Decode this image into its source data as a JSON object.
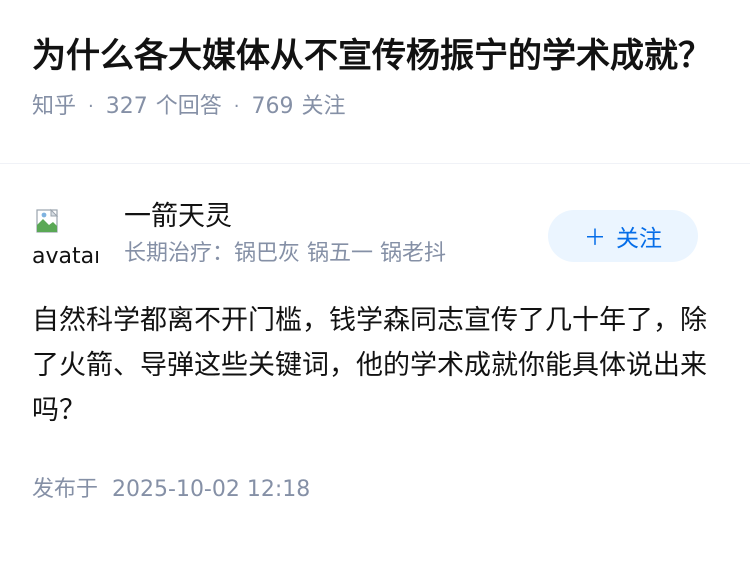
{
  "question": {
    "title": "为什么各大媒体从不宣传杨振宁的学术成就？",
    "source": "知乎",
    "answer_count": "327",
    "answer_label": "个回答",
    "follow_count": "769",
    "follow_label": "关注",
    "separator": "·"
  },
  "answer": {
    "author": {
      "name": "一箭天灵",
      "bio": "长期治疗：锅巴灰 锅五一 锅老抖",
      "avatar_alt": "avatar",
      "avatar_icon": "broken-image-icon"
    },
    "follow_button": {
      "icon": "plus",
      "label": "关注"
    },
    "content": "自然科学都离不开门槛，钱学森同志宣传了几十年了，除了火箭、导弹这些关键词，他的学术成就你能具体说出来吗？",
    "publish_label": "发布于",
    "publish_time": "2025-10-02 12:18"
  },
  "colors": {
    "text": "#121212",
    "meta": "#8590a6",
    "accent": "#056de8",
    "button_bg": "#ebf5ff"
  }
}
